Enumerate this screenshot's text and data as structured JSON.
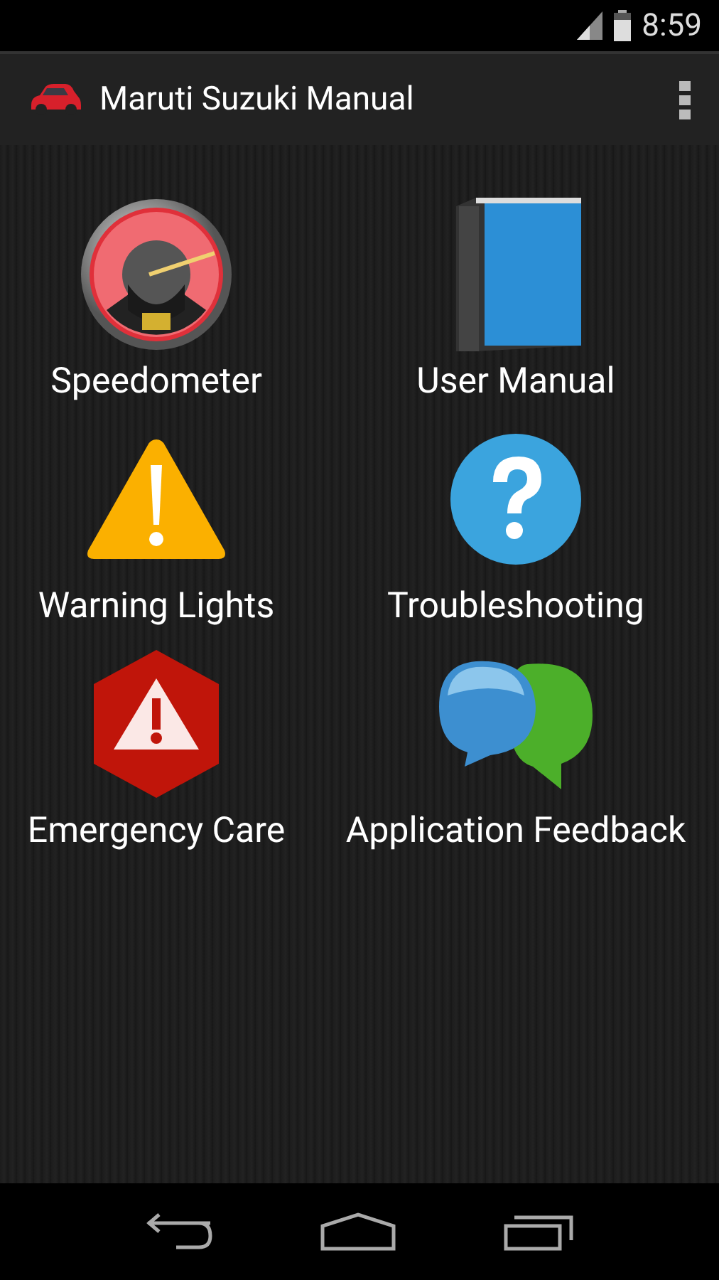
{
  "status_bar": {
    "time": "8:59"
  },
  "action_bar": {
    "title": "Maruti Suzuki Manual"
  },
  "menu_items": [
    {
      "label": "Speedometer",
      "kind": "speedometer"
    },
    {
      "label": "User Manual",
      "kind": "book"
    },
    {
      "label": "Warning Lights",
      "kind": "warning"
    },
    {
      "label": "Troubleshooting",
      "kind": "help"
    },
    {
      "label": "Emergency Care",
      "kind": "emergency"
    },
    {
      "label": "Application Feedback",
      "kind": "chat"
    }
  ]
}
